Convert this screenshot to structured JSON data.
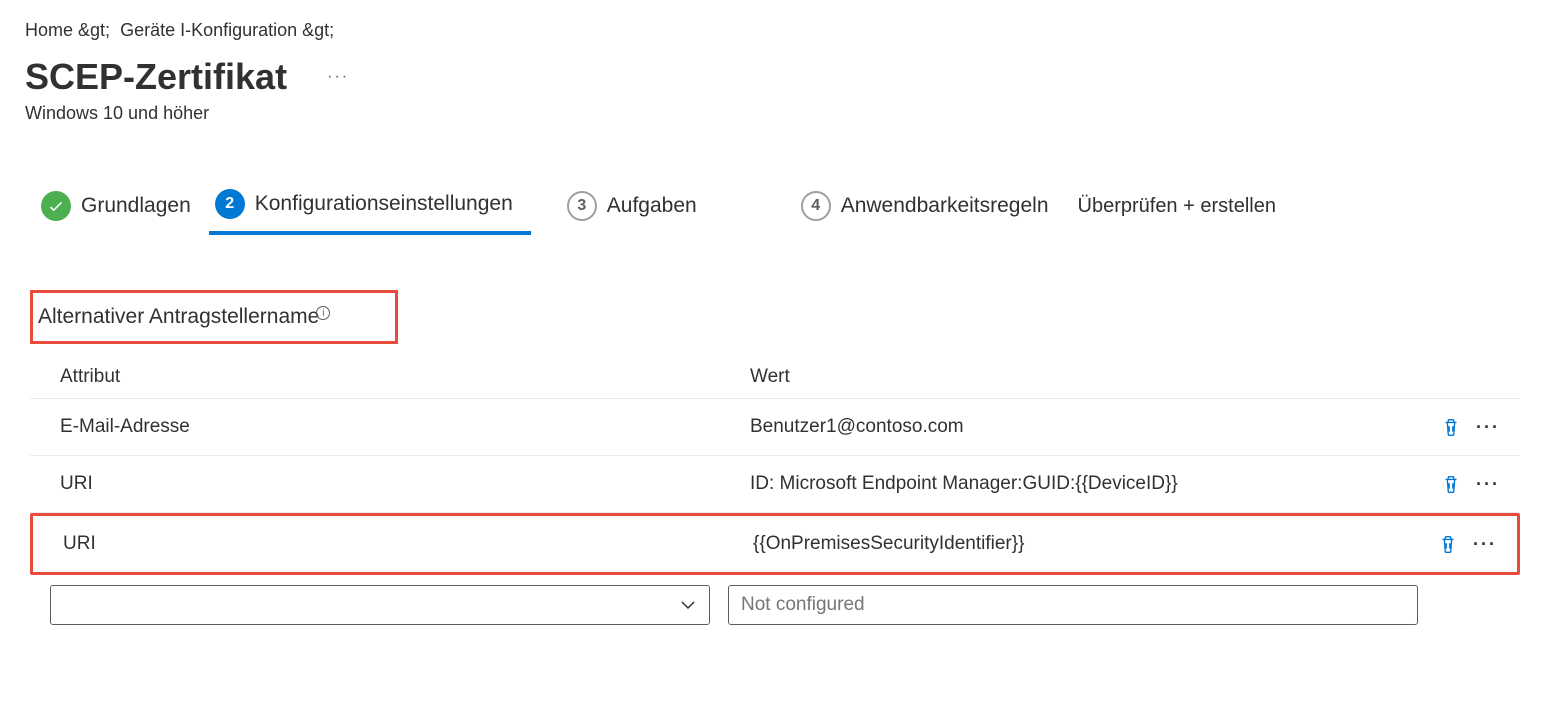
{
  "breadcrumb": {
    "items": [
      "Home &gt;",
      "Geräte I-Konfiguration &gt;"
    ]
  },
  "header": {
    "title": "SCEP-Zertifikat",
    "subtitle": "Windows 10 und höher"
  },
  "stepper": {
    "steps": [
      {
        "label": "Grundlagen",
        "state": "done"
      },
      {
        "label": "Konfigurationseinstellungen",
        "state": "current",
        "number": "2"
      },
      {
        "label": "Aufgaben",
        "state": "pending",
        "number": "3"
      },
      {
        "label": "Anwendbarkeitsregeln",
        "state": "pending",
        "number": "4"
      },
      {
        "label": "Überprüfen + erstellen",
        "state": "pending"
      }
    ]
  },
  "section": {
    "title": "Alternativer Antragstellername",
    "headers": {
      "attr": "Attribut",
      "value": "Wert"
    },
    "rows": [
      {
        "attr": "E-Mail-Adresse",
        "value": "Benutzer1@contoso.com"
      },
      {
        "attr": "URI",
        "value": "ID: Microsoft Endpoint Manager:GUID:{{DeviceID}}"
      },
      {
        "attr": "URI",
        "value": "{{OnPremisesSecurityIdentifier}}"
      }
    ],
    "input": {
      "placeholder": "Not configured"
    }
  }
}
